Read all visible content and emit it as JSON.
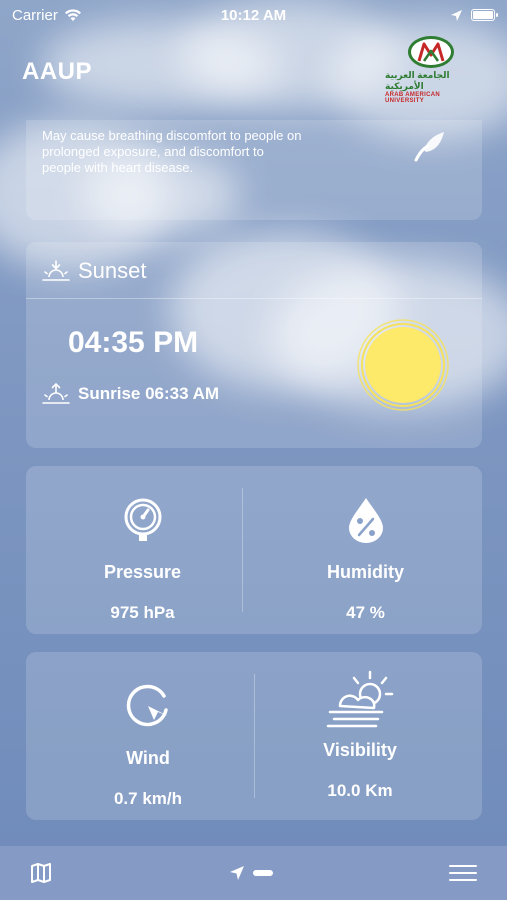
{
  "status_bar": {
    "carrier": "Carrier",
    "time": "10:12 AM"
  },
  "header": {
    "app_title": "AAUP",
    "logo_arabic": "الجامعة العربية الأمريكية",
    "logo_english": "ARAB AMERICAN UNIVERSITY"
  },
  "air_quality": {
    "description": "May cause breathing discomfort to people on prolonged exposure, and discomfort to people with heart disease."
  },
  "sun": {
    "sunset_label": "Sunset",
    "sunset_time": "04:35 PM",
    "sunrise_text": "Sunrise 06:33 AM"
  },
  "details": {
    "pressure_label": "Pressure",
    "pressure_value": "975 hPa",
    "humidity_label": "Humidity",
    "humidity_value": "47 %",
    "wind_label": "Wind",
    "wind_value": "0.7 km/h",
    "visibility_label": "Visibility",
    "visibility_value": "10.0 Km"
  },
  "colors": {
    "sun_fill": "#fde96a",
    "sun_ring": "#f5e25a",
    "background": "#7f98c2"
  }
}
